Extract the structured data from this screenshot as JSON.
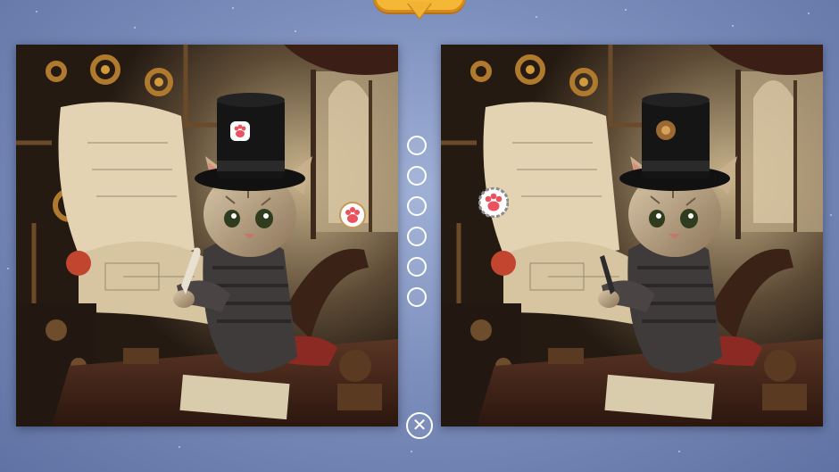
{
  "game": {
    "type": "spot-the-difference",
    "differences_total": 6,
    "differences_found": 3
  },
  "banner": {
    "color": "#f4b736"
  },
  "close_button": {
    "glyph": "✕",
    "icon": "close-icon"
  },
  "markers": [
    {
      "found": false
    },
    {
      "found": false
    },
    {
      "found": false
    },
    {
      "found": false
    },
    {
      "found": false
    },
    {
      "found": false
    }
  ],
  "found_badge": {
    "icon": "paw-icon",
    "color": "#e9525e"
  }
}
